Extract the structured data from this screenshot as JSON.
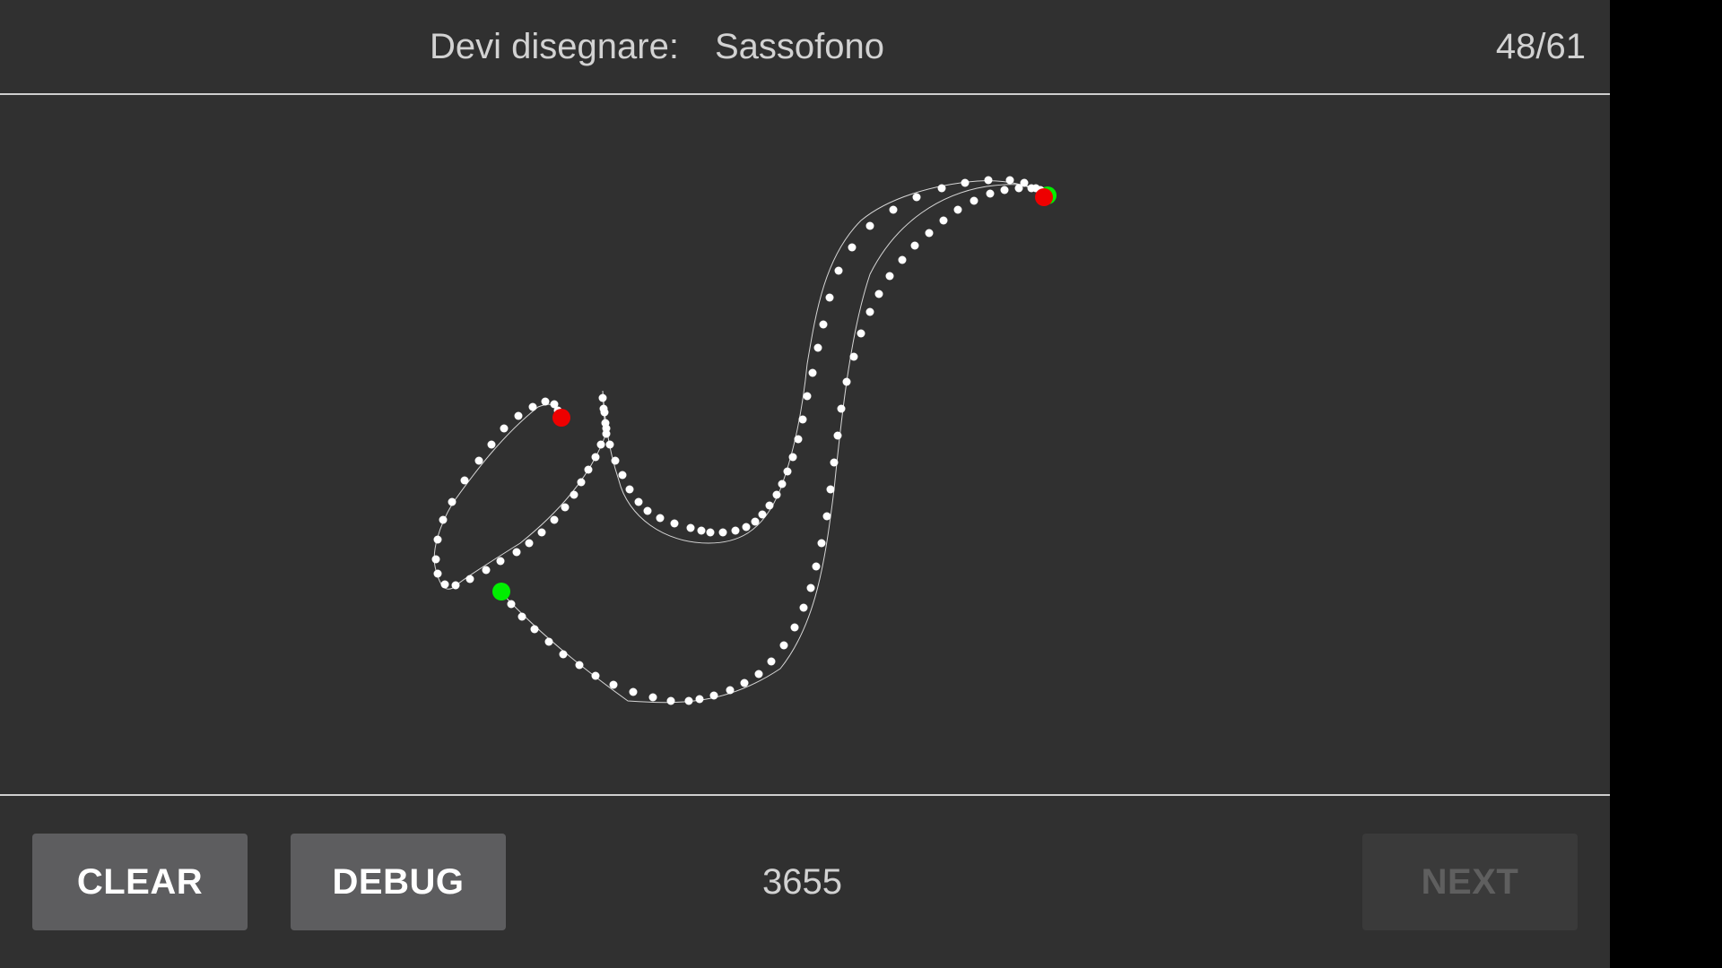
{
  "header": {
    "prompt_label": "Devi disegnare:",
    "prompt_word": "Sassofono",
    "progress": "48/61"
  },
  "footer": {
    "clear_label": "CLEAR",
    "debug_label": "DEBUG",
    "score": "3655",
    "next_label": "NEXT"
  },
  "colors": {
    "background": "#303030",
    "stroke_point": "#ffffff",
    "start_marker": "#00ee00",
    "end_marker": "#ee0000"
  },
  "button_states": {
    "next_enabled": false
  }
}
